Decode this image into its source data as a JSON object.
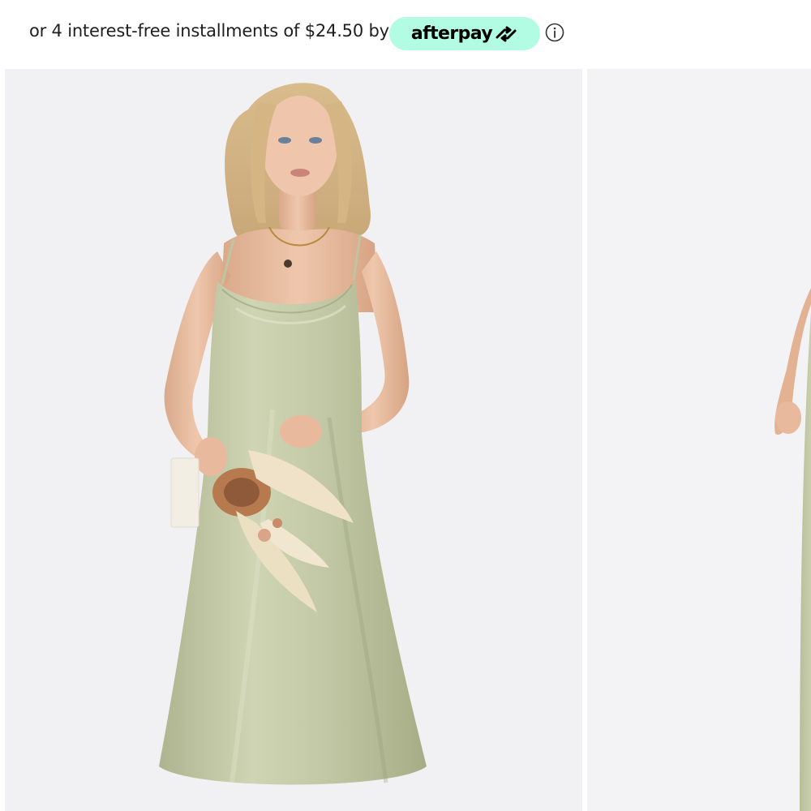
{
  "payment": {
    "installment_text": "or 4 interest-free installments of $24.50 by",
    "provider_label": "afterpay",
    "provider_logo_icon": "afterpay-arrows-icon",
    "pill_color": "#b2fce4",
    "info_icon": "info-circle-icon"
  },
  "gallery": {
    "images": [
      {
        "subject": "model in sage satin midi slip dress holding dried flower bouquet",
        "dress_color": "#c5cba8"
      },
      {
        "subject": "model in sage satin midi slip dress (partially visible)",
        "dress_color": "#c5cba8"
      }
    ]
  }
}
